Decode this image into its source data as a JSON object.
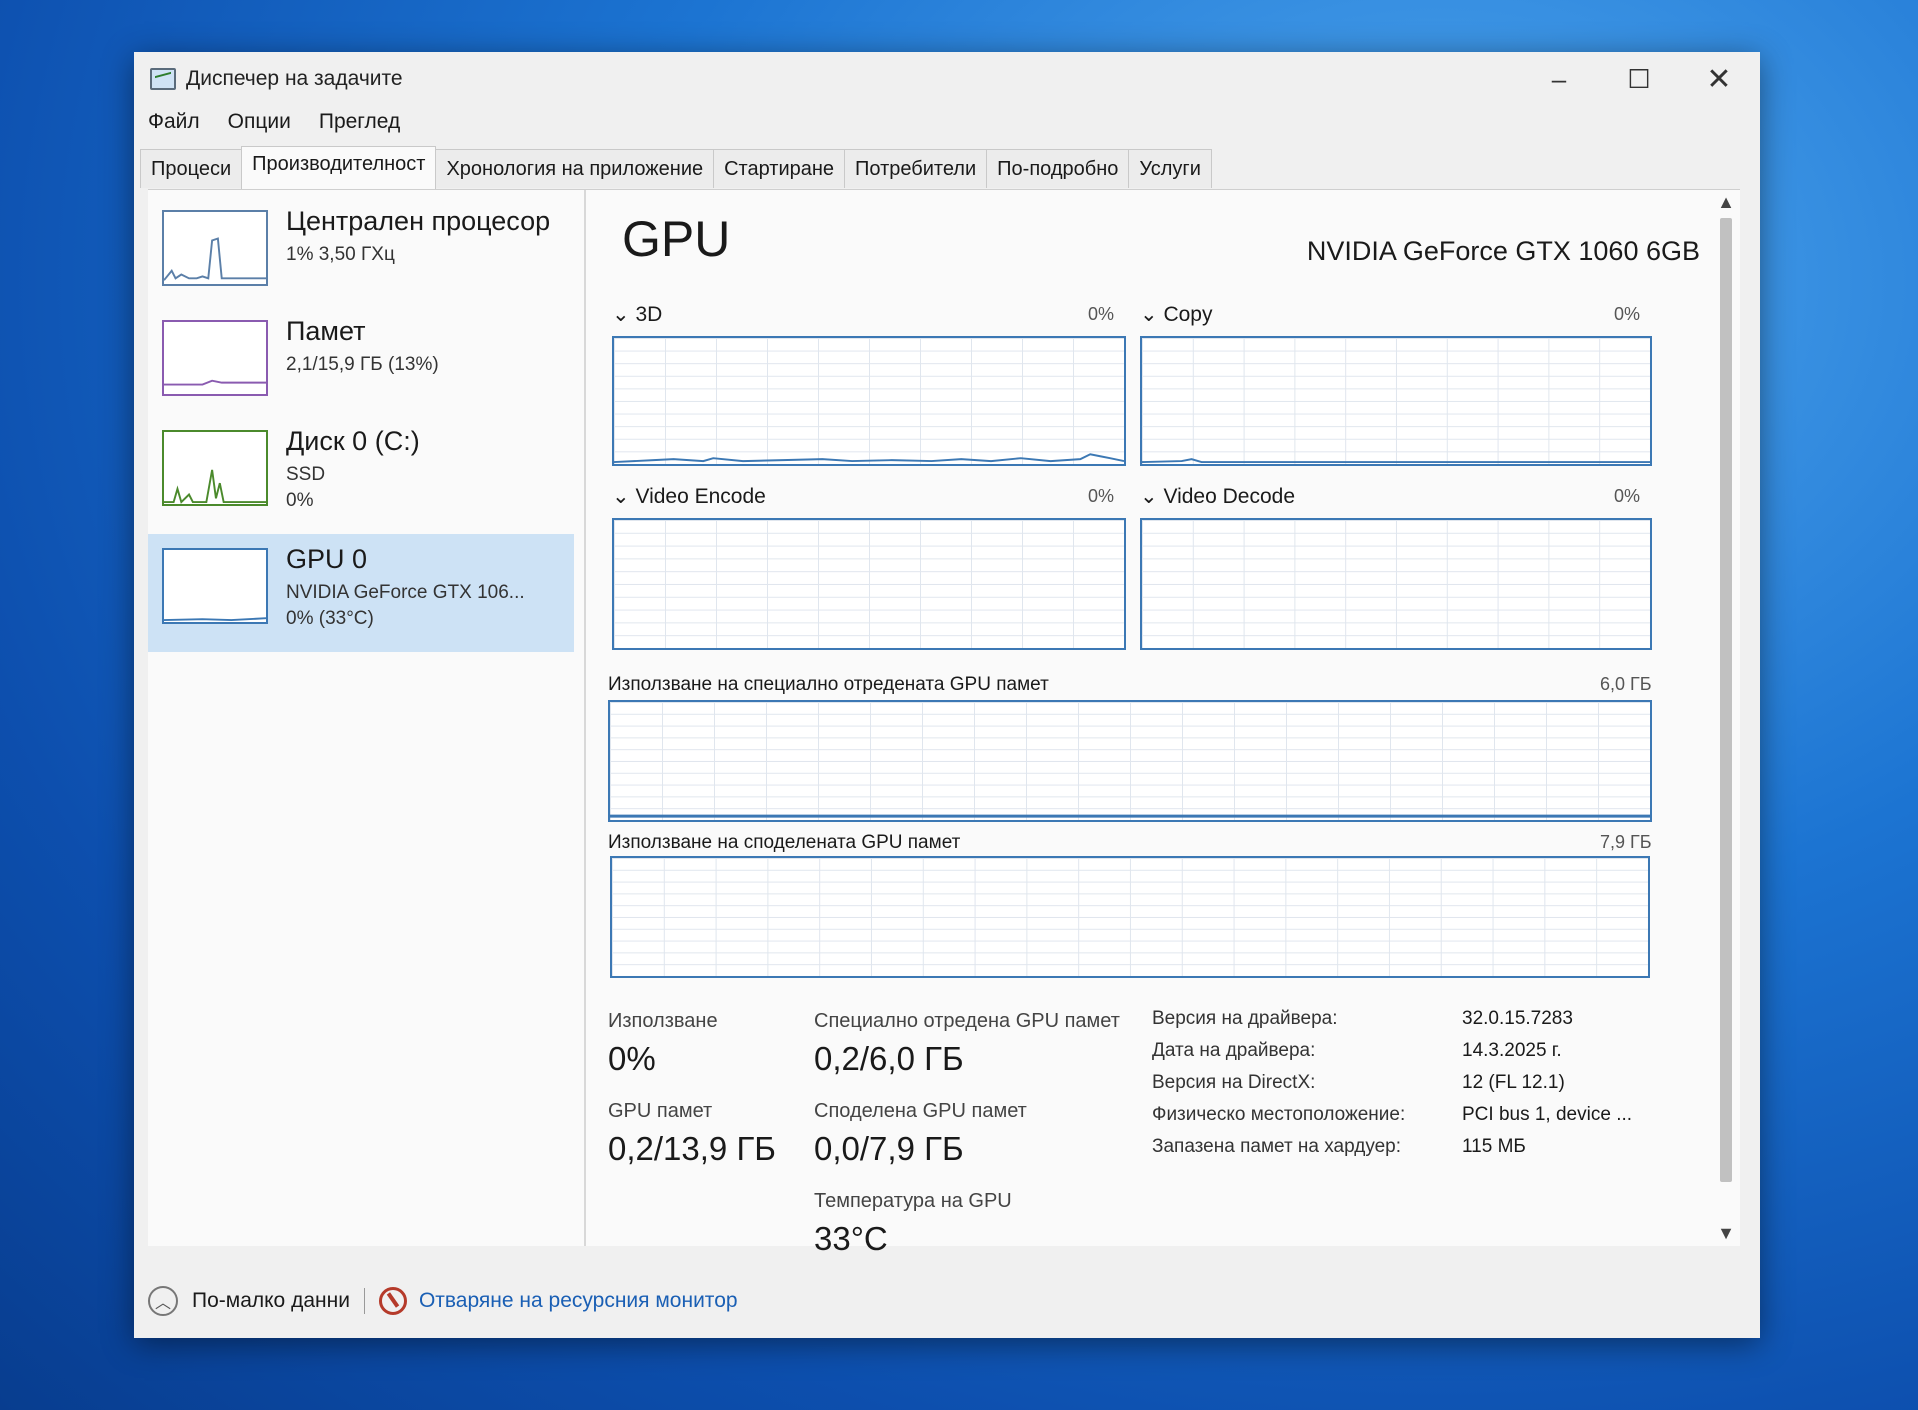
{
  "window": {
    "title": "Диспечер на задачите",
    "controls": {
      "minimize": "–",
      "maximize": "☐",
      "close": "✕"
    }
  },
  "menu": [
    "Файл",
    "Опции",
    "Преглед"
  ],
  "tabs": [
    "Процеси",
    "Производителност",
    "Хронология на приложение",
    "Стартиране",
    "Потребители",
    "По-подробно",
    "Услуги"
  ],
  "sidebar": {
    "cpu": {
      "title": "Централен процесор",
      "sub1": "1% 3,50 ГХц"
    },
    "memory": {
      "title": "Памет",
      "sub1": "2,1/15,9 ГБ (13%)"
    },
    "disk": {
      "title": "Диск 0 (C:)",
      "sub1": "SSD",
      "sub2": "0%"
    },
    "gpu": {
      "title": "GPU 0",
      "sub1": "NVIDIA GeForce GTX 106...",
      "sub2": "0% (33°C)"
    }
  },
  "gpu": {
    "heading": "GPU",
    "model": "NVIDIA GeForce GTX 1060 6GB",
    "engines": [
      {
        "name": "3D",
        "pct": "0%"
      },
      {
        "name": "Copy",
        "pct": "0%"
      },
      {
        "name": "Video Encode",
        "pct": "0%"
      },
      {
        "name": "Video Decode",
        "pct": "0%"
      }
    ],
    "dedicated_graph": {
      "label": "Използване на специално отредената GPU памет",
      "max": "6,0 ГБ"
    },
    "shared_graph": {
      "label": "Използване на споделената GPU памет",
      "max": "7,9 ГБ"
    },
    "stats": {
      "usage_label": "Използване",
      "usage_value": "0%",
      "dedicated_label": "Специално отредена GPU памет",
      "dedicated_value": "0,2/6,0 ГБ",
      "gpu_mem_label": "GPU памет",
      "gpu_mem_value": "0,2/13,9 ГБ",
      "shared_label": "Споделена GPU памет",
      "shared_value": "0,0/7,9 ГБ",
      "temp_label": "Температура на GPU",
      "temp_value": "33°C"
    },
    "info": [
      {
        "key": "Версия на драйвера:",
        "value": "32.0.15.7283"
      },
      {
        "key": "Дата на драйвера:",
        "value": "14.3.2025 г."
      },
      {
        "key": "Версия на DirectX:",
        "value": "12 (FL 12.1)"
      },
      {
        "key": "Физическо местоположение:",
        "value": "PCI bus 1, device ..."
      },
      {
        "key": "Запазена памет на хардуер:",
        "value": "115 МБ"
      }
    ]
  },
  "footer": {
    "less_details": "По-малко данни",
    "open_resmon": "Отваряне на ресурсния монитор"
  },
  "icons": {
    "app": "task-manager-icon",
    "collapse": "chevron-up-circle-icon",
    "resmon": "resource-monitor-icon",
    "scroll_up": "▲",
    "scroll_down": "▼",
    "expand": "⌄"
  },
  "colors": {
    "cpu_graph": "#5b7fa8",
    "disk_graph": "#4b8a2c",
    "gpu_graph": "#8a5bb0",
    "selected": "#cde2f5",
    "graph_border": "#3c78b4"
  }
}
